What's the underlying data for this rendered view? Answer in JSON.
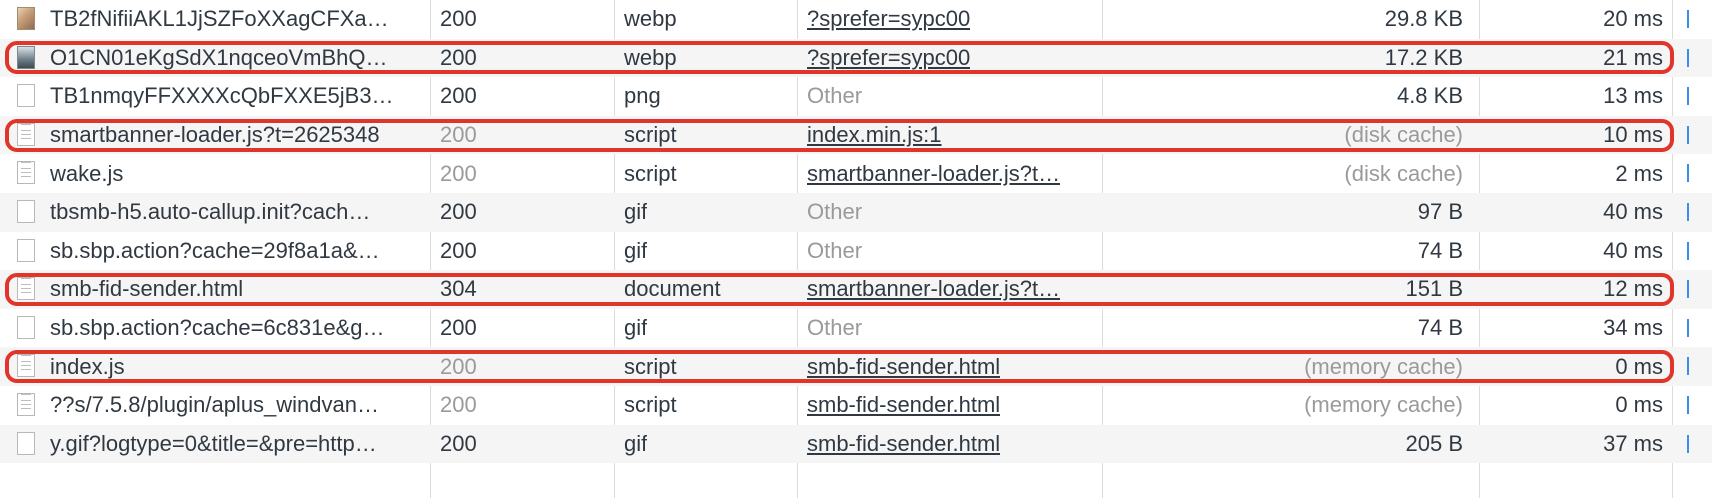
{
  "colors": {
    "highlight": "#e0352b",
    "timeline_bar": "#3a8ee6",
    "row_alt": "#f5f5f5"
  },
  "rows": [
    {
      "icon": "image-thumbnail-icon",
      "name": "TB2fNifiiAKL1JjSZFoXXagCFXa…",
      "status": "200",
      "type": "webp",
      "initiator": "?sprefer=sypc00",
      "initiator_link": true,
      "size": "29.8 KB",
      "time": "20 ms",
      "highlighted": false
    },
    {
      "icon": "image-thumbnail-icon",
      "name": "O1CN01eKgSdX1nqceoVmBhQ…",
      "status": "200",
      "type": "webp",
      "initiator": "?sprefer=sypc00",
      "initiator_link": true,
      "size": "17.2 KB",
      "time": "21 ms",
      "highlighted": true
    },
    {
      "icon": "blank-file-icon",
      "name": "TB1nmqyFFXXXXcQbFXXE5jB3…",
      "status": "200",
      "type": "png",
      "initiator": "Other",
      "initiator_link": false,
      "size": "4.8 KB",
      "time": "13 ms",
      "highlighted": false
    },
    {
      "icon": "document-file-icon",
      "name": "smartbanner-loader.js?t=2625348",
      "status": "200",
      "status_muted": true,
      "type": "script",
      "initiator": "index.min.js:1",
      "initiator_link": true,
      "size": "(disk cache)",
      "size_muted": true,
      "time": "10 ms",
      "highlighted": true
    },
    {
      "icon": "document-file-icon",
      "name": "wake.js",
      "status": "200",
      "status_muted": true,
      "type": "script",
      "initiator": "smartbanner-loader.js?t…",
      "initiator_link": true,
      "size": "(disk cache)",
      "size_muted": true,
      "time": "2 ms",
      "highlighted": false
    },
    {
      "icon": "blank-file-icon",
      "name": "tbsmb-h5.auto-callup.init?cach…",
      "status": "200",
      "type": "gif",
      "initiator": "Other",
      "initiator_link": false,
      "size": "97 B",
      "time": "40 ms",
      "highlighted": false
    },
    {
      "icon": "blank-file-icon",
      "name": "sb.sbp.action?cache=29f8a1a&…",
      "status": "200",
      "type": "gif",
      "initiator": "Other",
      "initiator_link": false,
      "size": "74 B",
      "time": "40 ms",
      "highlighted": false
    },
    {
      "icon": "document-file-icon",
      "name": "smb-fid-sender.html",
      "status": "304",
      "type": "document",
      "initiator": "smartbanner-loader.js?t…",
      "initiator_link": true,
      "size": "151 B",
      "time": "12 ms",
      "highlighted": true
    },
    {
      "icon": "blank-file-icon",
      "name": "sb.sbp.action?cache=6c831e&g…",
      "status": "200",
      "type": "gif",
      "initiator": "Other",
      "initiator_link": false,
      "size": "74 B",
      "time": "34 ms",
      "highlighted": false
    },
    {
      "icon": "document-file-icon",
      "name": "index.js",
      "status": "200",
      "status_muted": true,
      "type": "script",
      "initiator": "smb-fid-sender.html",
      "initiator_link": true,
      "size": "(memory cache)",
      "size_muted": true,
      "time": "0 ms",
      "highlighted": true
    },
    {
      "icon": "document-file-icon",
      "name": "??s/7.5.8/plugin/aplus_windvan…",
      "status": "200",
      "status_muted": true,
      "type": "script",
      "initiator": "smb-fid-sender.html",
      "initiator_link": true,
      "size": "(memory cache)",
      "size_muted": true,
      "time": "0 ms",
      "highlighted": false
    },
    {
      "icon": "blank-file-icon",
      "name": "y.gif?logtype=0&title=&pre=http…",
      "status": "200",
      "type": "gif",
      "initiator": "smb-fid-sender.html",
      "initiator_link": true,
      "size": "205 B",
      "time": "37 ms",
      "highlighted": false
    }
  ]
}
